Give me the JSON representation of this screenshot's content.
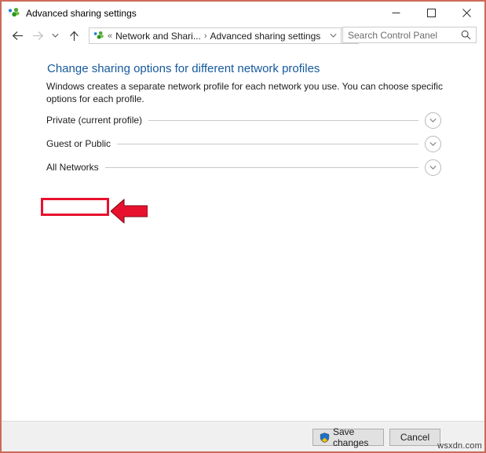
{
  "window": {
    "title": "Advanced sharing settings",
    "app_icon": "network-sharing-icon",
    "border_color": "#cc6a58",
    "controls": {
      "minimize": "−",
      "maximize": "☐",
      "close": "✕"
    }
  },
  "navbar": {
    "back": "←",
    "forward": "→",
    "recent": "∨",
    "up": "↑",
    "breadcrumb": {
      "leading_separator": "«",
      "items": [
        "Network and Shari...",
        "Advanced sharing settings"
      ],
      "separator": "›"
    },
    "address_dropdown": "∨",
    "refresh": "↻"
  },
  "search": {
    "placeholder": "Search Control Panel",
    "value": "",
    "icon": "search-icon"
  },
  "content": {
    "title": "Change sharing options for different network profiles",
    "title_color": "#15599c",
    "description": "Windows creates a separate network profile for each network you use. You can choose specific options for each profile.",
    "profiles": [
      {
        "label": "Private (current profile)",
        "expander": "∨",
        "expanded": false
      },
      {
        "label": "Guest or Public",
        "expander": "∨",
        "expanded": false
      },
      {
        "label": "All Networks",
        "expander": "∨",
        "expanded": false,
        "highlighted": true
      }
    ]
  },
  "annotation": {
    "color": "#e8112d",
    "target": "All Networks",
    "arrow_direction": "left"
  },
  "footer": {
    "save_label": "Save changes",
    "save_icon": "uac-shield-icon",
    "cancel_label": "Cancel"
  },
  "watermark": {
    "text": "wsxdn.com"
  }
}
